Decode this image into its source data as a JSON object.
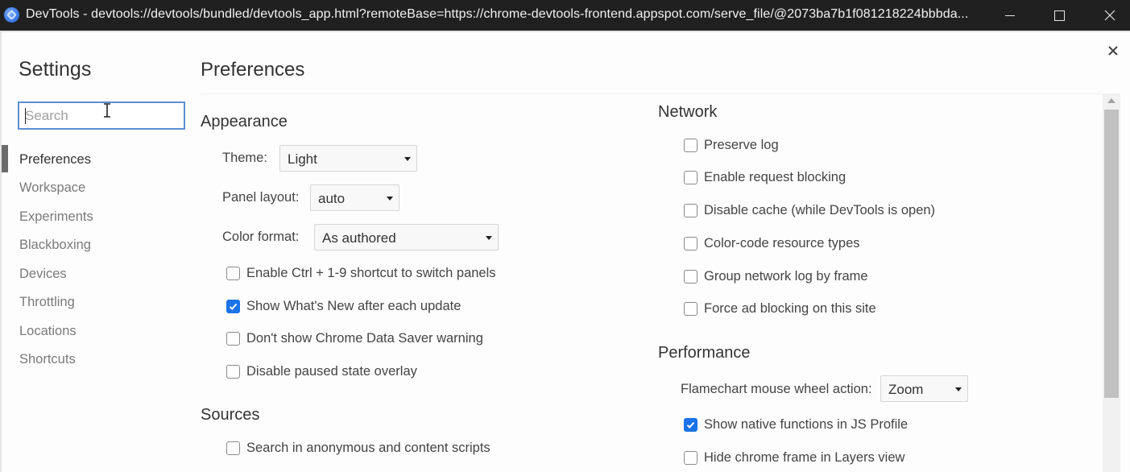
{
  "window": {
    "title": "DevTools - devtools://devtools/bundled/devtools_app.html?remoteBase=https://chrome-devtools-frontend.appspot.com/serve_file/@2073ba7b1f081218224bbbda...",
    "app_icon": "devtools-icon",
    "controls": [
      "minimize",
      "maximize",
      "close"
    ]
  },
  "settings": {
    "title": "Settings",
    "search": {
      "value": "",
      "placeholder": "Search"
    },
    "sidebar": {
      "active": "Preferences",
      "items": [
        {
          "label": "Preferences"
        },
        {
          "label": "Workspace"
        },
        {
          "label": "Experiments"
        },
        {
          "label": "Blackboxing"
        },
        {
          "label": "Devices"
        },
        {
          "label": "Throttling"
        },
        {
          "label": "Locations"
        },
        {
          "label": "Shortcuts"
        }
      ]
    },
    "close_icon": "close-icon"
  },
  "main": {
    "title": "Preferences",
    "appearance": {
      "heading": "Appearance",
      "theme": {
        "label": "Theme:",
        "value": "Light"
      },
      "panel_layout": {
        "label": "Panel layout:",
        "value": "auto"
      },
      "color_format": {
        "label": "Color format:",
        "value": "As authored"
      },
      "checkboxes": [
        {
          "label": "Enable Ctrl + 1-9 shortcut to switch panels",
          "checked": false
        },
        {
          "label": "Show What's New after each update",
          "checked": true
        },
        {
          "label": "Don't show Chrome Data Saver warning",
          "checked": false
        },
        {
          "label": "Disable paused state overlay",
          "checked": false
        }
      ]
    },
    "sources": {
      "heading": "Sources",
      "checkboxes": [
        {
          "label": "Search in anonymous and content scripts",
          "checked": false
        }
      ]
    },
    "network": {
      "heading": "Network",
      "checkboxes": [
        {
          "label": "Preserve log",
          "checked": false
        },
        {
          "label": "Enable request blocking",
          "checked": false
        },
        {
          "label": "Disable cache (while DevTools is open)",
          "checked": false
        },
        {
          "label": "Color-code resource types",
          "checked": false
        },
        {
          "label": "Group network log by frame",
          "checked": false
        },
        {
          "label": "Force ad blocking on this site",
          "checked": false
        }
      ]
    },
    "performance": {
      "heading": "Performance",
      "flamechart": {
        "label": "Flamechart mouse wheel action:",
        "value": "Zoom"
      },
      "checkboxes": [
        {
          "label": "Show native functions in JS Profile",
          "checked": true
        },
        {
          "label": "Hide chrome frame in Layers view",
          "checked": false
        }
      ]
    }
  },
  "colors": {
    "titlebar_bg": "#202020",
    "accent": "#1a73e8",
    "search_border": "#5b8fd3",
    "active_indicator": "#6b6b6b"
  }
}
